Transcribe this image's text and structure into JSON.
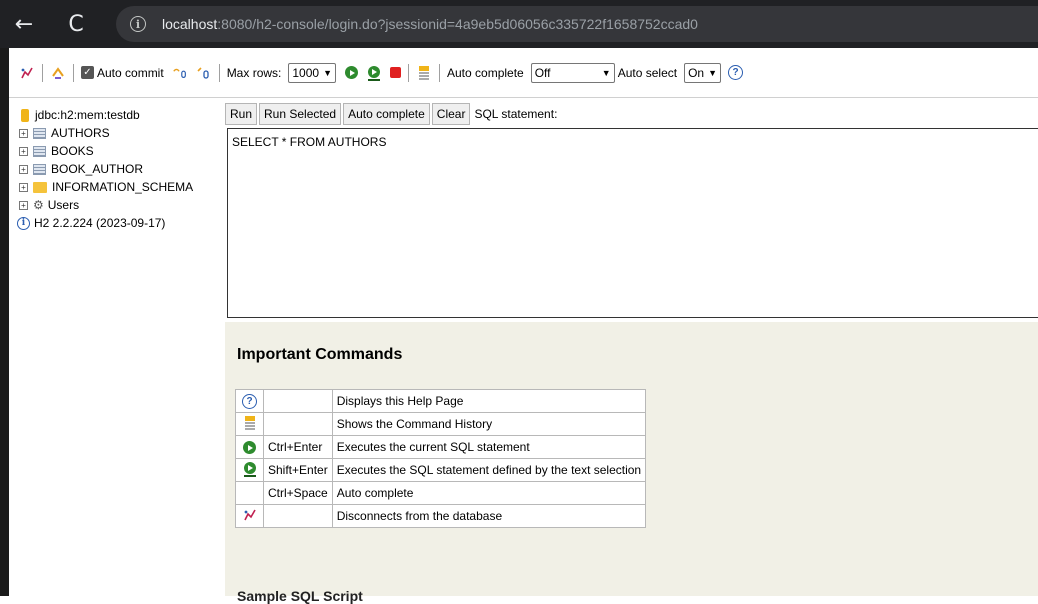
{
  "browser": {
    "back_glyph": "←",
    "reload_glyph": "C",
    "info_glyph": "i",
    "url_host": "localhost",
    "url_rest": ":8080/h2-console/login.do?jsessionid=4a9eb5d06056c335722f1658752ccad0"
  },
  "toolbar": {
    "auto_commit_label": "Auto commit",
    "max_rows_label": "Max rows:",
    "max_rows_value": "1000",
    "auto_complete_label": "Auto complete",
    "auto_complete_value": "Off",
    "auto_select_label": "Auto select",
    "auto_select_value": "On",
    "help_glyph": "?",
    "icons": [
      "disconnect-icon",
      "refresh-icon",
      "rollback-icon",
      "commit-icon",
      "run-icon",
      "run-selected-icon",
      "stop-icon",
      "history-icon",
      "help-icon"
    ]
  },
  "tree": {
    "connection": "jdbc:h2:mem:testdb",
    "items": [
      {
        "label": "AUTHORS",
        "type": "table"
      },
      {
        "label": "BOOKS",
        "type": "table"
      },
      {
        "label": "BOOK_AUTHOR",
        "type": "table"
      },
      {
        "label": "INFORMATION_SCHEMA",
        "type": "folder"
      },
      {
        "label": "Users",
        "type": "users"
      }
    ],
    "version": "H2 2.2.224 (2023-09-17)"
  },
  "query": {
    "run_label": "Run",
    "run_selected_label": "Run Selected",
    "auto_complete_label": "Auto complete",
    "clear_label": "Clear",
    "sql_statement_label": "SQL statement:",
    "sql_text": "SELECT * FROM AUTHORS"
  },
  "help": {
    "title": "Important Commands",
    "rows": [
      {
        "icon": "help-icon",
        "keys": "",
        "desc": "Displays this Help Page"
      },
      {
        "icon": "history-icon",
        "keys": "",
        "desc": "Shows the Command History"
      },
      {
        "icon": "run-icon",
        "keys": "Ctrl+Enter",
        "desc": "Executes the current SQL statement"
      },
      {
        "icon": "run-selected-icon",
        "keys": "Shift+Enter",
        "desc": "Executes the SQL statement defined by the text selection"
      },
      {
        "icon": "",
        "keys": "Ctrl+Space",
        "desc": "Auto complete"
      },
      {
        "icon": "disconnect-icon",
        "keys": "",
        "desc": "Disconnects from the database"
      }
    ],
    "next_heading_partial": "Sample SQL Script"
  }
}
